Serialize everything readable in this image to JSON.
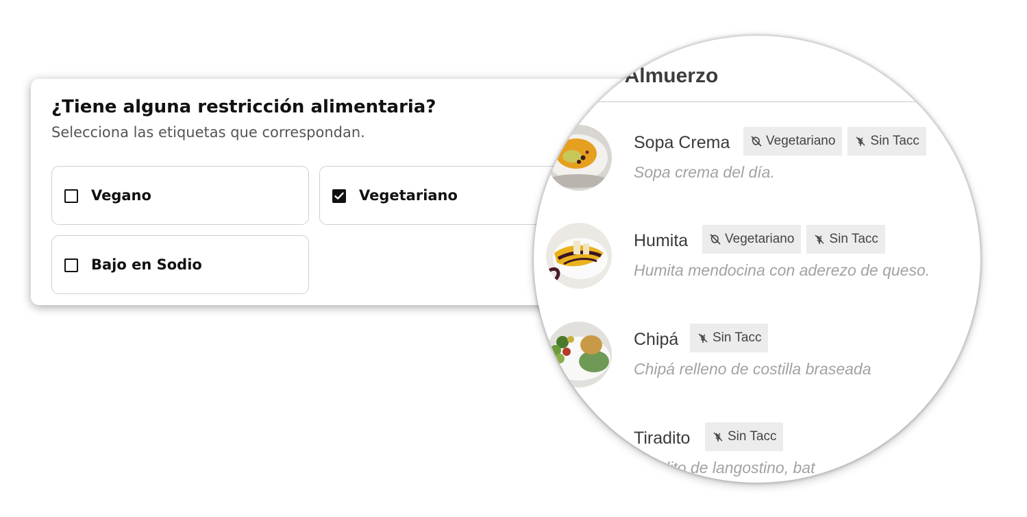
{
  "form": {
    "title": "¿Tiene alguna restricción alimentaria?",
    "subtitle": "Selecciona las etiquetas que correspondan.",
    "options": [
      {
        "label": "Vegano",
        "checked": false
      },
      {
        "label": "Vegetariano",
        "checked": true
      },
      {
        "label": "Bajo en Sodio",
        "checked": false
      }
    ]
  },
  "menu": {
    "section_title": "as Almuerzo",
    "dishes": [
      {
        "name": "Sopa Crema",
        "tags": [
          "Vegetariano",
          "Sin Tacc"
        ],
        "description": "Sopa crema del día."
      },
      {
        "name": "Humita",
        "tags": [
          "Vegetariano",
          "Sin Tacc"
        ],
        "description": "Humita mendocina con aderezo de queso."
      },
      {
        "name": "Chipá",
        "tags": [
          "Sin Tacc"
        ],
        "description": "Chipá relleno de costilla braseada"
      },
      {
        "name": "Tiradito",
        "tags": [
          "Sin Tacc"
        ],
        "description": "Tiradito de langostino, bat"
      }
    ]
  },
  "icons": {
    "vegetariano": "no-meat-icon",
    "sin_tacc": "no-wheat-icon",
    "checkbox_checked": "check-icon"
  }
}
